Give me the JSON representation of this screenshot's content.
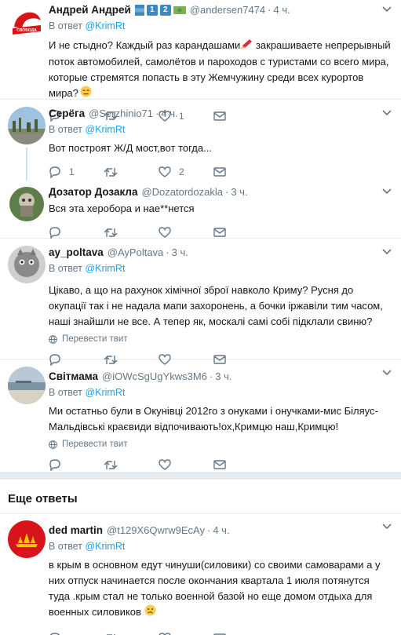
{
  "reply_to_label": "В ответ",
  "reply_to_handle": "@KrimRt",
  "translate_label": "Перевести твит",
  "more_replies_title": "Еще ответы",
  "tweets": [
    {
      "name": "Андрей Андрей",
      "name_badges": [
        "1",
        "2"
      ],
      "handle": "@andersen7474",
      "time": "4 ч.",
      "text_part1": "И не стыдно? Каждый раз карандашами",
      "text_part2": " закрашиваете непрерывный поток автомобилей, самолётов и пароходов с туристами со всего мира, которые стремятся попасть в эту Жемчужину среди всех курортов мира?",
      "reply_count": "",
      "retweet_count": "",
      "like_count": "1",
      "avatar_text": "СВОБОДА ВЫБОР"
    },
    {
      "name": "Серёга",
      "handle": "@Serzhinio71",
      "time": "4 ч.",
      "text": "Вот построят Ж/Д мост,вот тогда...",
      "reply_count": "1",
      "retweet_count": "",
      "like_count": "2"
    },
    {
      "name": "Дозатор Дозакла",
      "handle": "@Dozatordozakla",
      "time": "3 ч.",
      "text": "Вся эта херобора и нае**нется",
      "reply_count": "",
      "retweet_count": "",
      "like_count": ""
    },
    {
      "name": "ay_poltava",
      "handle": "@AyPoltava",
      "time": "3 ч.",
      "text": "Цікаво, а що на рахунок хімічної зброї навколо Криму? Русня до окупації так і не надала мапи захоронень, а бочки іржавіли тим часом, наші знайшли не все. А тепер як, москалі самі собі підклали свиню?",
      "reply_count": "",
      "retweet_count": "",
      "like_count": ""
    },
    {
      "name": "Світмама",
      "handle": "@iOWcSgUgYkws3M6",
      "time": "3 ч.",
      "text": "Ми остатньо були в Окунівці 2012го з онуками і онучками-мис Біляус-Мальдівські краєвиди відпочивають!ох,Кримцю наш,Кримцю!",
      "reply_count": "",
      "retweet_count": "",
      "like_count": ""
    },
    {
      "name": "ded martin",
      "handle": "@t129X6Qwrw9EcAy",
      "time": "4 ч.",
      "text": "в крым в основном едут чинуши(силовики) со своими самоварами а у них отпуск начинается после окончания квартала 1 июля потянутся туда .крым стал не только военной базой но еще домом отдыха для военных силовиков",
      "reply_count": "",
      "retweet_count": "",
      "like_count": ""
    }
  ],
  "colors": {
    "link": "#1da1f2",
    "secondary_text": "#657786",
    "separator": "#e6ecf0",
    "thread_line": "#c4e4f7"
  }
}
